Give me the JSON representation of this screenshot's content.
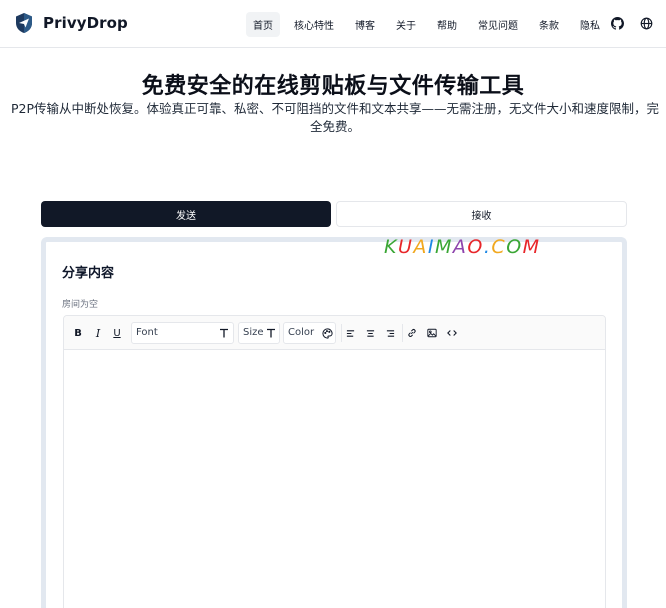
{
  "brand": {
    "name": "PrivyDrop",
    "logo_icon": "shield-logo-icon"
  },
  "nav": {
    "items": [
      {
        "label": "首页",
        "active": true
      },
      {
        "label": "核心特性",
        "active": false
      },
      {
        "label": "博客",
        "active": false
      },
      {
        "label": "关于",
        "active": false
      },
      {
        "label": "帮助",
        "active": false
      },
      {
        "label": "常见问题",
        "active": false
      },
      {
        "label": "条款",
        "active": false
      },
      {
        "label": "隐私",
        "active": false
      }
    ],
    "github_icon": "github-icon",
    "language_icon": "globe-icon"
  },
  "hero": {
    "title": "免费安全的在线剪贴板与文件传输工具",
    "subtitle": "P2P传输从中断处恢复。体验真正可靠、私密、不可阻挡的文件和文本共享——无需注册，无文件大小和速度限制，完全免费。"
  },
  "tabs": {
    "send": "发送",
    "receive": "接收",
    "active": "send"
  },
  "card": {
    "title": "分享内容",
    "room_status": "房间为空"
  },
  "toolbar": {
    "bold": "B",
    "italic": "I",
    "underline": "U",
    "font_label": "Font",
    "size_label": "Size",
    "color_label": "Color",
    "icons": [
      "bold-icon",
      "italic-icon",
      "underline-icon",
      "font-icon",
      "size-icon",
      "palette-icon",
      "align-left-icon",
      "align-center-icon",
      "align-right-icon",
      "link-icon",
      "image-icon",
      "code-icon"
    ]
  },
  "watermark": {
    "text": "KUAIMAO.COM",
    "colors": [
      "#3aa635",
      "#e8262a",
      "#f1a81f",
      "#1e88e5",
      "#3aa635",
      "#8e44ad",
      "#e8262a",
      "#1e88e5",
      "#f1a81f",
      "#3aa635",
      "#e8262a"
    ]
  },
  "colors": {
    "primary": "#111827",
    "active_nav_bg": "#f1f3f5",
    "card_border": "#e2e8f0"
  }
}
